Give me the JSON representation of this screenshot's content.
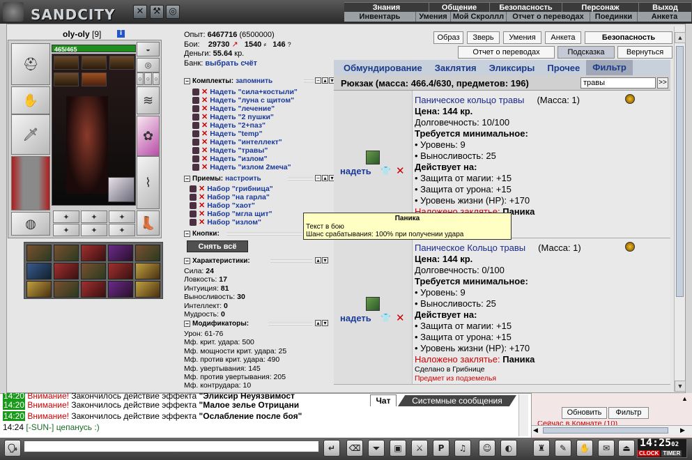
{
  "top": {
    "logo": "SANDCITY",
    "menu1": [
      "Знания",
      "Общение",
      "Безопасность",
      "Персонаж",
      "Выход"
    ],
    "menu2": [
      "Инвентарь",
      "Умения",
      "Мой Скроллл",
      "Отчет о переводах",
      "Поединки",
      "Анкета"
    ]
  },
  "character": {
    "name": "oly-oly",
    "level": "[9]",
    "hp": "465/465"
  },
  "stats": {
    "exp_label": "Опыт:",
    "exp": "6467716",
    "exp_next": "(6500000)",
    "fights_label": "Бои:",
    "wins": "29730",
    "losses": "1540",
    "draws": "146",
    "money_label": "Деньги:",
    "money": "55.64",
    "money_unit": "кр.",
    "bank_label": "Банк:",
    "bank_link": "выбрать счёт"
  },
  "sets": {
    "title": "Комплекты:",
    "remember": "запомнить",
    "items": [
      "Надеть \"сила+костыли\"",
      "Надеть \"луна с щитом\"",
      "Надеть \"лечение\"",
      "Надеть \"2 пушки\"",
      "Надеть \"2+паз\"",
      "Надеть \"temp\"",
      "Надеть \"интеллект\"",
      "Надеть \"травы\"",
      "Надеть \"излом\"",
      "Надеть \"излом 2меча\""
    ]
  },
  "tricks": {
    "title": "Приемы:",
    "configure": "настроить",
    "items": [
      "Набор \"грибница\"",
      "Набор \"на гарла\"",
      "Набор \"хаот\"",
      "Набор \"мгла щит\"",
      "Набор \"излом\""
    ]
  },
  "buttons_sect": {
    "title": "Кнопки:",
    "remove_all": "Снять всё"
  },
  "characteristics": {
    "title": "Характеристики:",
    "items": [
      [
        "Сила:",
        "24"
      ],
      [
        "Ловкость:",
        "17"
      ],
      [
        "Интуиция:",
        "81"
      ],
      [
        "Выносливость:",
        "30"
      ],
      [
        "Интеллект:",
        "0"
      ],
      [
        "Мудрость:",
        "0"
      ]
    ]
  },
  "modifiers": {
    "title": "Модификаторы:",
    "items": [
      "Урон: 61-76",
      "Мф. крит. удара: 500",
      "Мф. мощности крит. удара: 25",
      "Мф. против крит. удара: 490",
      "Мф. увертывания: 145",
      "Мф. против увертывания: 205",
      "Мф. контрудара: 10"
    ]
  },
  "right_buttons": {
    "row1": [
      "Образ",
      "Зверь",
      "Умения",
      "Анкета",
      "Безопасность"
    ],
    "row2": [
      "Отчет о переводах",
      "Подсказка",
      "Вернуться"
    ]
  },
  "tabs": [
    "Обмундирование",
    "Заклятия",
    "Эликсиры",
    "Прочее",
    "Фильтр"
  ],
  "bag": {
    "title": "Рюкзак (масса: 466.4/630, предметов: 196)",
    "filter": "травы",
    "go": ">>"
  },
  "items": [
    {
      "put_on": "надеть",
      "name": "Паническое кольцо травы",
      "mass": "(Масса: 1)",
      "price": "Цена: 144 кр.",
      "durability": "Долговечность: 10/100",
      "req_title": "Требуется минимальное:",
      "req": [
        "• Уровень: 9",
        "• Выносливость: 25"
      ],
      "acts_title": "Действует на:",
      "acts": [
        "• Защита от магии: +15",
        "• Защита от урона: +15",
        "• Уровень жизни (HP): +170"
      ],
      "spell_label": "Наложено заклятье:",
      "spell": "Паника"
    },
    {
      "put_on": "надеть",
      "name": "Паническое Кольцо травы",
      "mass": "(Масса: 1)",
      "price": "Цена: 144 кр.",
      "durability": "Долговечность: 0/100",
      "req_title": "Требуется минимальное:",
      "req": [
        "• Уровень: 9",
        "• Выносливость: 25"
      ],
      "acts_title": "Действует на:",
      "acts": [
        "• Защита от магии: +15",
        "• Защита от урона: +15",
        "• Уровень жизни (HP): +170"
      ],
      "spell_label": "Наложено заклятье:",
      "spell": "Паника",
      "made": "Сделано в Грибнице",
      "dungeon": "Предмет из подземелья"
    }
  ],
  "tooltip": {
    "title": "Паника",
    "line1": "Текст в бою",
    "line2": "Шанс срабатывания: 100% при получении удара"
  },
  "chat": {
    "tabs": [
      "Чат",
      "Системные сообщения"
    ],
    "lines": [
      {
        "time": "14:20",
        "warn": "Внимание!",
        "text": " Закончилось действие эффекта ",
        "bold": "\"Малое зелье Отрицани"
      },
      {
        "time": "14:20",
        "warn": "Внимание!",
        "text": " Закончилось действие эффекта ",
        "bold": "\"Ослабление после боя\""
      },
      {
        "time": "14:24",
        "warn": "",
        "text": " [-SUN-] цепанусь :)",
        "bold": ""
      }
    ]
  },
  "right_chat": {
    "refresh": "Обновить",
    "filter": "Фильтр"
  },
  "clock": {
    "time": "14:25",
    "sec": "02",
    "clock": "CLOCK",
    "timer": "TIMER"
  }
}
